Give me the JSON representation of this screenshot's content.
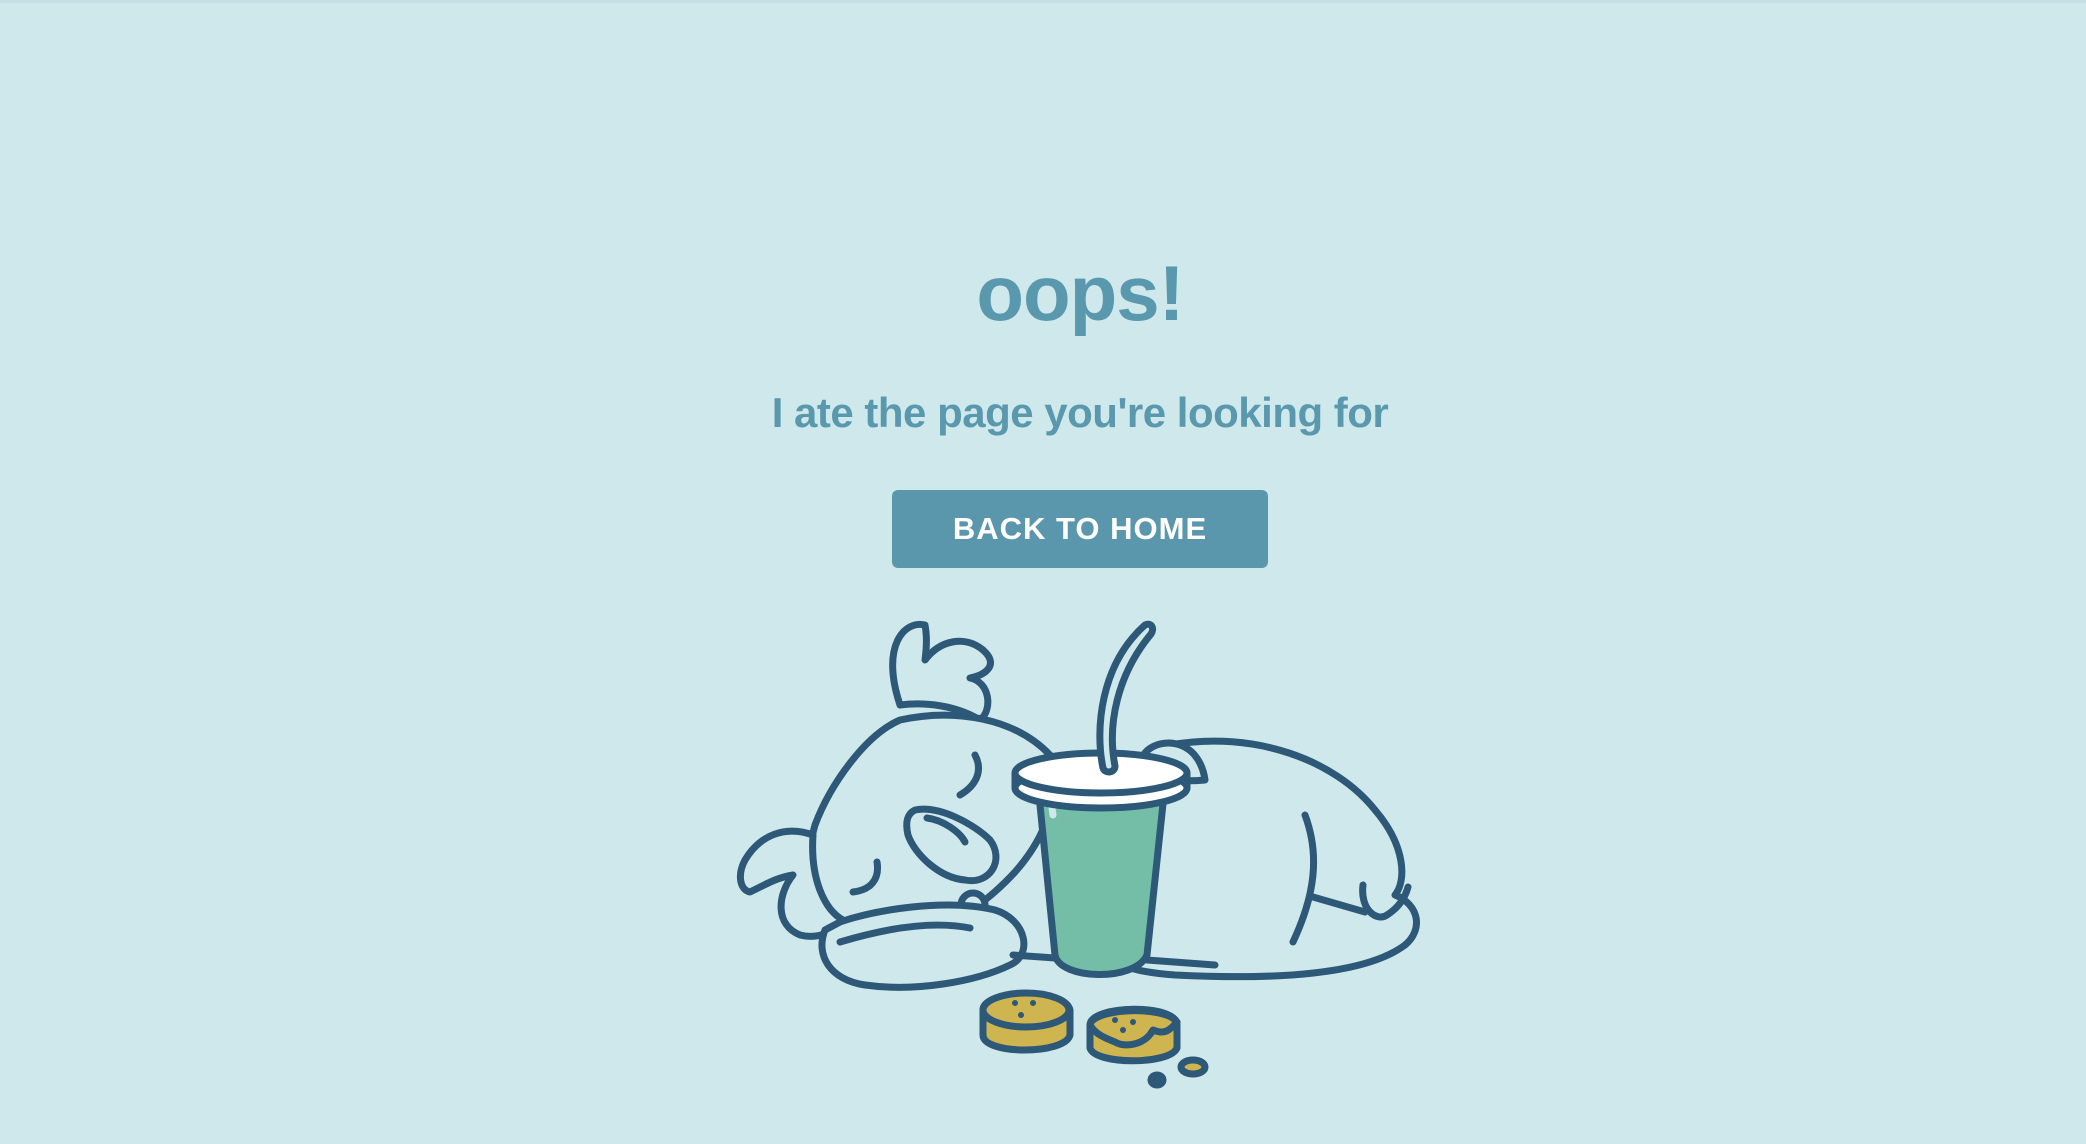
{
  "page": {
    "heading": "oops!",
    "message": "I ate the page you're looking for",
    "back_button_label": "BACK TO HOME"
  },
  "illustration": {
    "icon": "koala-sleeping-on-cup-illustration",
    "colors": {
      "background": "#cfe8ec",
      "outline": "#2e5878",
      "koala_fill": "#cfe8ec",
      "cup_fill": "#74bea8",
      "lid_fill": "#ffffff",
      "cookie_fill": "#cfb550"
    }
  },
  "theme": {
    "text_color": "#5a98ae",
    "button_color": "#5a97ad",
    "button_text_color": "#ffffff"
  }
}
